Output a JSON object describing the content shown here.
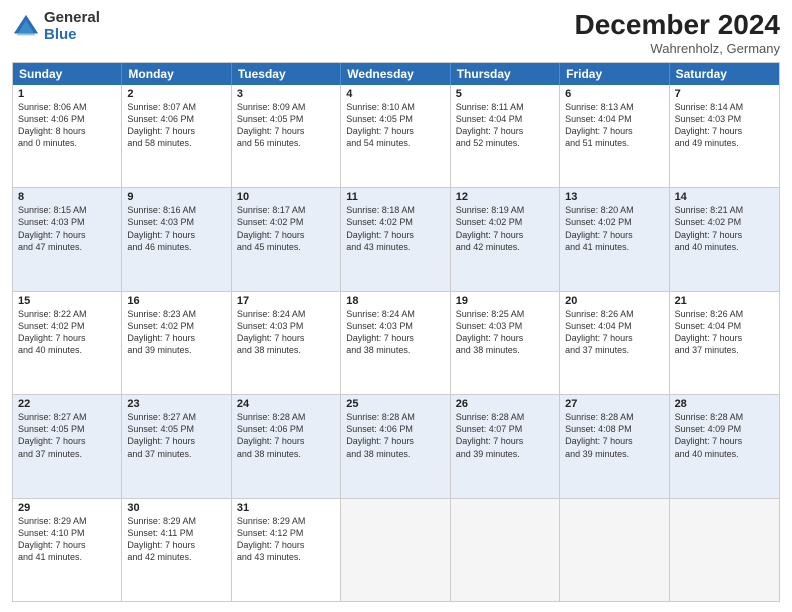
{
  "logo": {
    "general": "General",
    "blue": "Blue"
  },
  "header": {
    "title": "December 2024",
    "location": "Wahrenholz, Germany"
  },
  "days": [
    "Sunday",
    "Monday",
    "Tuesday",
    "Wednesday",
    "Thursday",
    "Friday",
    "Saturday"
  ],
  "rows": [
    [
      {
        "day": "1",
        "lines": [
          "Sunrise: 8:06 AM",
          "Sunset: 4:06 PM",
          "Daylight: 8 hours",
          "and 0 minutes."
        ]
      },
      {
        "day": "2",
        "lines": [
          "Sunrise: 8:07 AM",
          "Sunset: 4:06 PM",
          "Daylight: 7 hours",
          "and 58 minutes."
        ]
      },
      {
        "day": "3",
        "lines": [
          "Sunrise: 8:09 AM",
          "Sunset: 4:05 PM",
          "Daylight: 7 hours",
          "and 56 minutes."
        ]
      },
      {
        "day": "4",
        "lines": [
          "Sunrise: 8:10 AM",
          "Sunset: 4:05 PM",
          "Daylight: 7 hours",
          "and 54 minutes."
        ]
      },
      {
        "day": "5",
        "lines": [
          "Sunrise: 8:11 AM",
          "Sunset: 4:04 PM",
          "Daylight: 7 hours",
          "and 52 minutes."
        ]
      },
      {
        "day": "6",
        "lines": [
          "Sunrise: 8:13 AM",
          "Sunset: 4:04 PM",
          "Daylight: 7 hours",
          "and 51 minutes."
        ]
      },
      {
        "day": "7",
        "lines": [
          "Sunrise: 8:14 AM",
          "Sunset: 4:03 PM",
          "Daylight: 7 hours",
          "and 49 minutes."
        ]
      }
    ],
    [
      {
        "day": "8",
        "lines": [
          "Sunrise: 8:15 AM",
          "Sunset: 4:03 PM",
          "Daylight: 7 hours",
          "and 47 minutes."
        ]
      },
      {
        "day": "9",
        "lines": [
          "Sunrise: 8:16 AM",
          "Sunset: 4:03 PM",
          "Daylight: 7 hours",
          "and 46 minutes."
        ]
      },
      {
        "day": "10",
        "lines": [
          "Sunrise: 8:17 AM",
          "Sunset: 4:02 PM",
          "Daylight: 7 hours",
          "and 45 minutes."
        ]
      },
      {
        "day": "11",
        "lines": [
          "Sunrise: 8:18 AM",
          "Sunset: 4:02 PM",
          "Daylight: 7 hours",
          "and 43 minutes."
        ]
      },
      {
        "day": "12",
        "lines": [
          "Sunrise: 8:19 AM",
          "Sunset: 4:02 PM",
          "Daylight: 7 hours",
          "and 42 minutes."
        ]
      },
      {
        "day": "13",
        "lines": [
          "Sunrise: 8:20 AM",
          "Sunset: 4:02 PM",
          "Daylight: 7 hours",
          "and 41 minutes."
        ]
      },
      {
        "day": "14",
        "lines": [
          "Sunrise: 8:21 AM",
          "Sunset: 4:02 PM",
          "Daylight: 7 hours",
          "and 40 minutes."
        ]
      }
    ],
    [
      {
        "day": "15",
        "lines": [
          "Sunrise: 8:22 AM",
          "Sunset: 4:02 PM",
          "Daylight: 7 hours",
          "and 40 minutes."
        ]
      },
      {
        "day": "16",
        "lines": [
          "Sunrise: 8:23 AM",
          "Sunset: 4:02 PM",
          "Daylight: 7 hours",
          "and 39 minutes."
        ]
      },
      {
        "day": "17",
        "lines": [
          "Sunrise: 8:24 AM",
          "Sunset: 4:03 PM",
          "Daylight: 7 hours",
          "and 38 minutes."
        ]
      },
      {
        "day": "18",
        "lines": [
          "Sunrise: 8:24 AM",
          "Sunset: 4:03 PM",
          "Daylight: 7 hours",
          "and 38 minutes."
        ]
      },
      {
        "day": "19",
        "lines": [
          "Sunrise: 8:25 AM",
          "Sunset: 4:03 PM",
          "Daylight: 7 hours",
          "and 38 minutes."
        ]
      },
      {
        "day": "20",
        "lines": [
          "Sunrise: 8:26 AM",
          "Sunset: 4:04 PM",
          "Daylight: 7 hours",
          "and 37 minutes."
        ]
      },
      {
        "day": "21",
        "lines": [
          "Sunrise: 8:26 AM",
          "Sunset: 4:04 PM",
          "Daylight: 7 hours",
          "and 37 minutes."
        ]
      }
    ],
    [
      {
        "day": "22",
        "lines": [
          "Sunrise: 8:27 AM",
          "Sunset: 4:05 PM",
          "Daylight: 7 hours",
          "and 37 minutes."
        ]
      },
      {
        "day": "23",
        "lines": [
          "Sunrise: 8:27 AM",
          "Sunset: 4:05 PM",
          "Daylight: 7 hours",
          "and 37 minutes."
        ]
      },
      {
        "day": "24",
        "lines": [
          "Sunrise: 8:28 AM",
          "Sunset: 4:06 PM",
          "Daylight: 7 hours",
          "and 38 minutes."
        ]
      },
      {
        "day": "25",
        "lines": [
          "Sunrise: 8:28 AM",
          "Sunset: 4:06 PM",
          "Daylight: 7 hours",
          "and 38 minutes."
        ]
      },
      {
        "day": "26",
        "lines": [
          "Sunrise: 8:28 AM",
          "Sunset: 4:07 PM",
          "Daylight: 7 hours",
          "and 39 minutes."
        ]
      },
      {
        "day": "27",
        "lines": [
          "Sunrise: 8:28 AM",
          "Sunset: 4:08 PM",
          "Daylight: 7 hours",
          "and 39 minutes."
        ]
      },
      {
        "day": "28",
        "lines": [
          "Sunrise: 8:28 AM",
          "Sunset: 4:09 PM",
          "Daylight: 7 hours",
          "and 40 minutes."
        ]
      }
    ],
    [
      {
        "day": "29",
        "lines": [
          "Sunrise: 8:29 AM",
          "Sunset: 4:10 PM",
          "Daylight: 7 hours",
          "and 41 minutes."
        ]
      },
      {
        "day": "30",
        "lines": [
          "Sunrise: 8:29 AM",
          "Sunset: 4:11 PM",
          "Daylight: 7 hours",
          "and 42 minutes."
        ]
      },
      {
        "day": "31",
        "lines": [
          "Sunrise: 8:29 AM",
          "Sunset: 4:12 PM",
          "Daylight: 7 hours",
          "and 43 minutes."
        ]
      },
      {
        "day": "",
        "lines": []
      },
      {
        "day": "",
        "lines": []
      },
      {
        "day": "",
        "lines": []
      },
      {
        "day": "",
        "lines": []
      }
    ]
  ]
}
